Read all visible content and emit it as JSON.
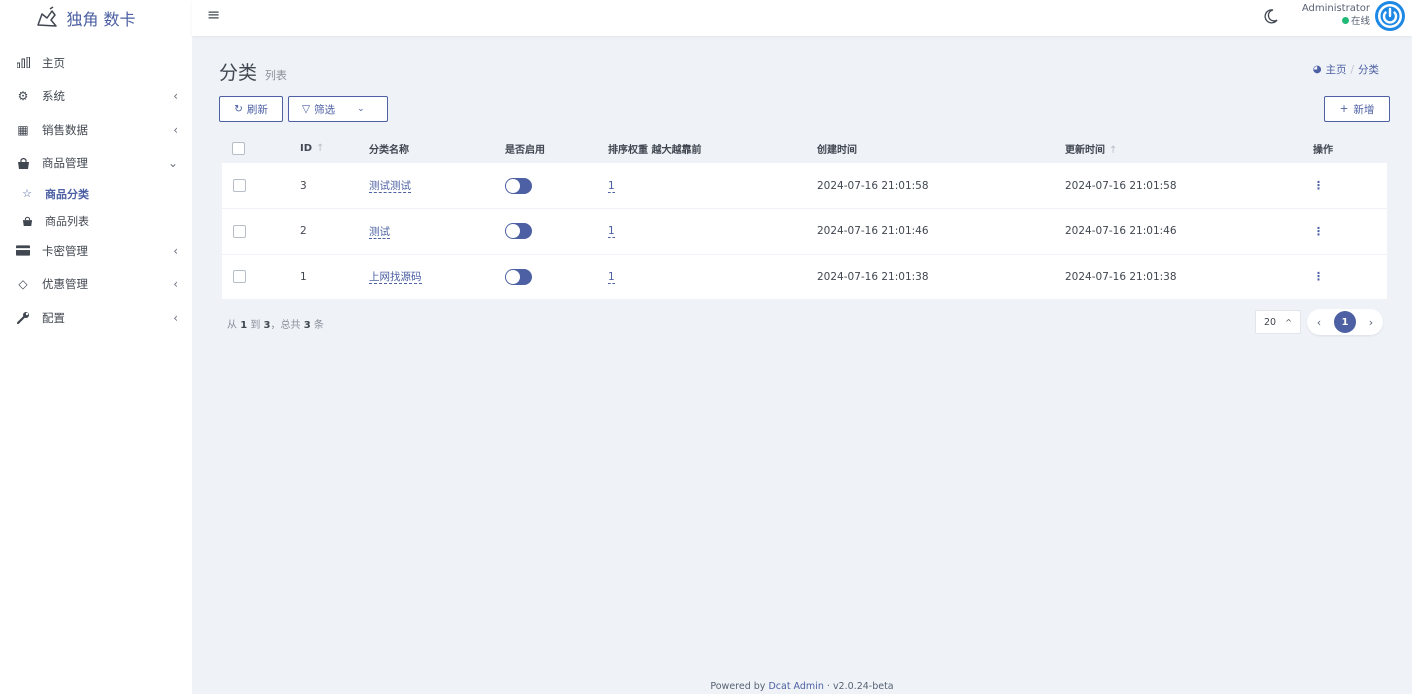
{
  "app": {
    "logo_text": "独角 数卡"
  },
  "sidebar": {
    "items": [
      {
        "label": "主页",
        "icon": "bar-chart-icon",
        "glyph": "▮▮",
        "has_arrow": false
      },
      {
        "label": "系统",
        "icon": "gear-icon",
        "glyph": "⚙",
        "has_arrow": true,
        "arrow": "‹"
      },
      {
        "label": "销售数据",
        "icon": "table-icon",
        "glyph": "▦",
        "has_arrow": true,
        "arrow": "‹"
      },
      {
        "label": "商品管理",
        "icon": "shopping-bag-icon",
        "glyph": "◭",
        "has_arrow": true,
        "arrow": "⌄"
      },
      {
        "label": "卡密管理",
        "icon": "credit-card-icon",
        "glyph": "▬",
        "has_arrow": true,
        "arrow": "‹"
      },
      {
        "label": "优惠管理",
        "icon": "diamond-icon",
        "glyph": "◇",
        "has_arrow": true,
        "arrow": "‹"
      },
      {
        "label": "配置",
        "icon": "wrench-icon",
        "glyph": "🔧",
        "has_arrow": true,
        "arrow": "‹"
      }
    ],
    "sub_items": [
      {
        "label": "商品分类",
        "icon": "star-icon",
        "glyph": "☆",
        "active": true
      },
      {
        "label": "商品列表",
        "icon": "shopping-bag-icon",
        "glyph": "◭",
        "active": false
      }
    ]
  },
  "topbar": {
    "user_name": "Administrator",
    "user_status": "在线"
  },
  "header": {
    "title": "分类",
    "subtitle": "列表"
  },
  "breadcrumb": {
    "home": "主页",
    "separator": "/",
    "current": "分类"
  },
  "toolbar": {
    "refresh_label": "刷新",
    "filter_label": "筛选",
    "new_label": "新增"
  },
  "table": {
    "columns": [
      "ID",
      "分类名称",
      "是否启用",
      "排序权重 越大越靠前",
      "创建时间",
      "更新时间",
      "操作"
    ],
    "sort_arrow": "↑",
    "rows": [
      {
        "id": "3",
        "name": "测试测试",
        "enabled": true,
        "sort": "1",
        "created": "2024-07-16 21:01:58",
        "updated": "2024-07-16 21:01:58",
        "action": "⋮"
      },
      {
        "id": "2",
        "name": "测试",
        "enabled": true,
        "sort": "1",
        "created": "2024-07-16 21:01:46",
        "updated": "2024-07-16 21:01:46",
        "action": "⋮"
      },
      {
        "id": "1",
        "name": "上网找源码",
        "enabled": true,
        "sort": "1",
        "created": "2024-07-16 21:01:38",
        "updated": "2024-07-16 21:01:38",
        "action": "⋮"
      }
    ]
  },
  "pagination": {
    "summary_from": "从",
    "from": "1",
    "to_word": "到",
    "to": "3",
    "total_word": "，总共",
    "total": "3",
    "unit": "条",
    "per_page": "20",
    "current_page": "1",
    "prev": "‹",
    "next": "›"
  },
  "footer": {
    "prefix": "Powered by",
    "link": "Dcat Admin",
    "dot": "·",
    "version": "v2.0.24-beta"
  },
  "colors": {
    "primary": "#4c60a3",
    "background": "#eff3f8",
    "online": "#21b978"
  }
}
